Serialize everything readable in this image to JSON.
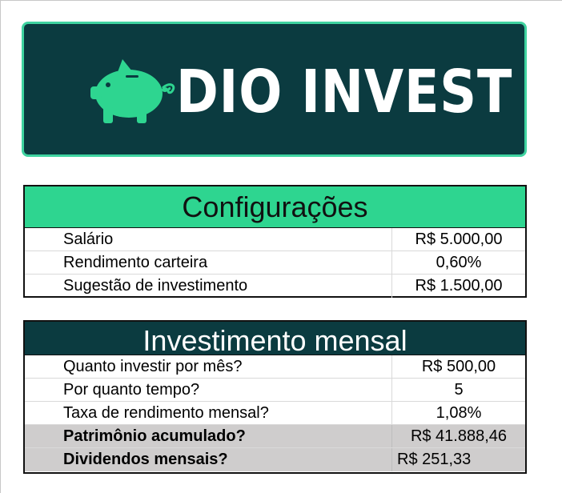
{
  "brand": {
    "title": "DIO INVEST",
    "icon": "piggy-bank-icon",
    "colors": {
      "background": "#0b3b40",
      "accent": "#2ed590",
      "border": "#3fd3a0",
      "text": "#ffffff"
    }
  },
  "config": {
    "heading": "Configurações",
    "rows": [
      {
        "label": "Salário",
        "value": "R$ 5.000,00"
      },
      {
        "label": "Rendimento carteira",
        "value": "0,60%"
      },
      {
        "label": "Sugestão de investimento",
        "value": "R$ 1.500,00"
      }
    ]
  },
  "monthly": {
    "heading": "Investimento mensal",
    "rows": [
      {
        "label": "Quanto investir por mês?",
        "value": "R$ 500,00"
      },
      {
        "label": "Por quanto tempo?",
        "value": "5"
      },
      {
        "label": "Taxa de rendimento mensal?",
        "value": "1,08%"
      },
      {
        "label": "Patrimônio acumulado?",
        "value": "R$ 41.888,46"
      },
      {
        "label": "Dividendos mensais?",
        "value": "R$ 251,33"
      }
    ],
    "shaded_color": "#cfcdcd"
  }
}
